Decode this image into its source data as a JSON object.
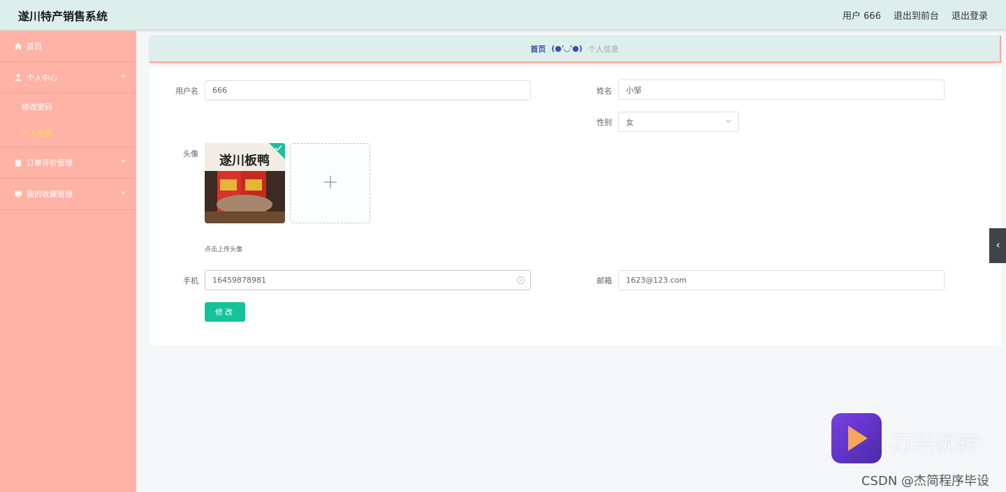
{
  "header": {
    "title": "遂川特产销售系统",
    "user": "用户 666",
    "back_front": "退出到前台",
    "logout": "退出登录"
  },
  "sidebar": {
    "items": [
      {
        "label": "首页",
        "icon": "home-icon"
      },
      {
        "label": "个人中心",
        "icon": "user-icon",
        "children": [
          {
            "label": "修改密码"
          },
          {
            "label": "个人信息",
            "active": true
          }
        ]
      },
      {
        "label": "订单评价管理",
        "icon": "clipboard-icon"
      },
      {
        "label": "我的收藏管理",
        "icon": "monitor-icon"
      }
    ]
  },
  "breadcrumb": {
    "home": "首页",
    "sep": "(●'◡'●)",
    "current": "个人信息"
  },
  "form": {
    "username_label": "用户名",
    "username_value": "666",
    "name_label": "姓名",
    "name_value": "小邹",
    "gender_label": "性别",
    "gender_value": "女",
    "avatar_label": "头像",
    "avatar_image_text": "遂川板鸭",
    "upload_tip": "点击上传头像",
    "phone_label": "手机",
    "phone_value": "16459878981",
    "email_label": "邮箱",
    "email_value": "1623@123.com",
    "submit_label": "修改"
  },
  "watermark": {
    "brand": "万兴优转",
    "csdn": "CSDN @杰简程序毕设"
  },
  "colors": {
    "sidebar_bg": "#ffb3a6",
    "topbar_bg": "#dcefea",
    "accent": "#17c29a",
    "active_menu": "#ffe14d"
  }
}
